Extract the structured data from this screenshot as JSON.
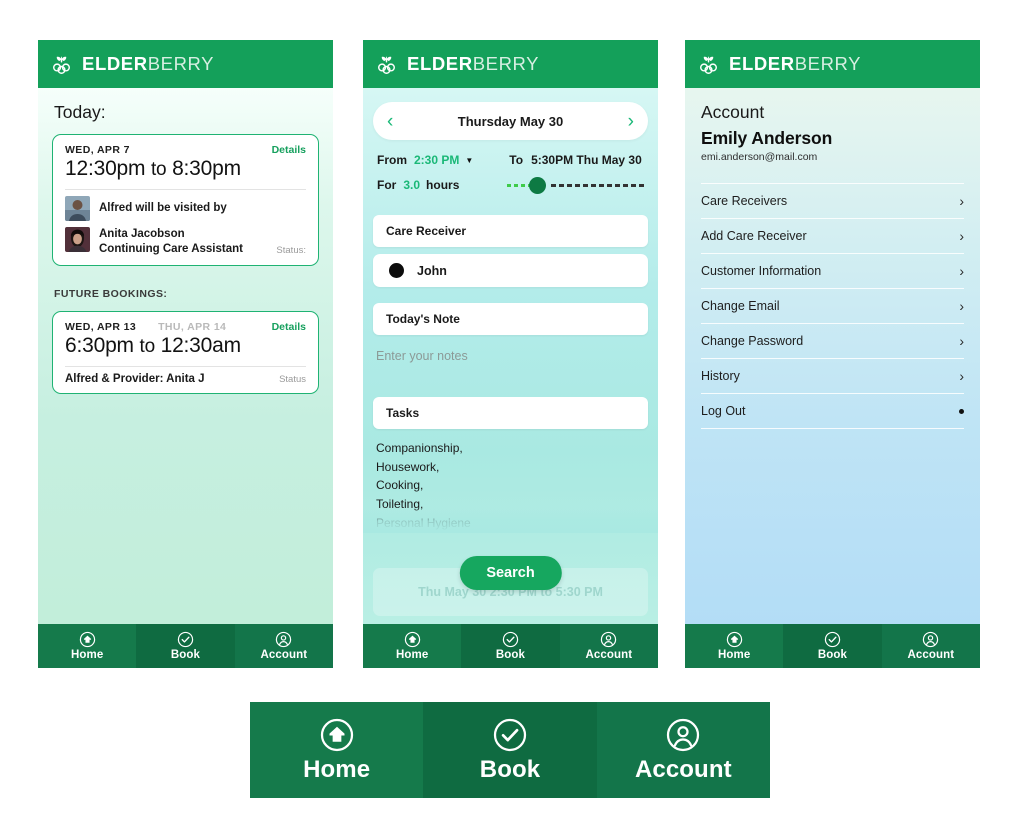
{
  "brand": {
    "strong": "ELDER",
    "light": "BERRY",
    "logo_icon": "elderberry-logo-icon",
    "bar_color": "#14a05a"
  },
  "nav": {
    "items": [
      {
        "label": "Home",
        "icon": "home-circle-icon"
      },
      {
        "label": "Book",
        "icon": "check-circle-icon"
      },
      {
        "label": "Account",
        "icon": "user-circle-icon"
      }
    ]
  },
  "home": {
    "title": "Today:",
    "today_booking": {
      "date": "WED, APR 7",
      "details_label": "Details",
      "time_from": "12:30pm",
      "time_sep": "to",
      "time_to": "8:30pm",
      "receiver_line": "Alfred will be visited by",
      "provider_name": "Anita Jacobson",
      "provider_role": "Continuing Care Assistant",
      "status_label": "Status:"
    },
    "future_label": "FUTURE BOOKINGS:",
    "future_booking": {
      "date_start": "WED, APR 13",
      "date_end": "THU, APR 14",
      "details_label": "Details",
      "time_from": "6:30pm",
      "time_sep": "to",
      "time_to": "12:30am",
      "summary": "Alfred & Provider: Anita J",
      "status_label": "Status"
    }
  },
  "book": {
    "date_nav": {
      "prev_icon": "chevron-left-icon",
      "next_icon": "chevron-right-icon",
      "date": "Thursday May 30"
    },
    "time": {
      "from_label": "From",
      "from_value": "2:30 PM",
      "dropdown_icon": "caret-down-icon",
      "to_label": "To",
      "to_value": "5:30PM Thu May 30",
      "for_label": "For",
      "duration_value": "3.0",
      "hours_label": "hours",
      "slider_icon": "duration-slider"
    },
    "care_receiver": {
      "heading": "Care Receiver",
      "selected": "John"
    },
    "note": {
      "heading": "Today's Note",
      "placeholder": "Enter your notes"
    },
    "tasks": {
      "heading": "Tasks",
      "items": [
        "Companionship,",
        "Housework,",
        "Cooking,",
        "Toileting,",
        "Personal Hygiene"
      ]
    },
    "search_button": "Search",
    "summary_ghost": "Thu May 30 2:30 PM to 5:30 PM"
  },
  "account": {
    "title": "Account",
    "name": "Emily Anderson",
    "email": "emi.anderson@mail.com",
    "items": [
      {
        "label": "Care Receivers",
        "accessory": "chevron"
      },
      {
        "label": "Add Care Receiver",
        "accessory": "chevron"
      },
      {
        "label": "Customer Information",
        "accessory": "chevron"
      },
      {
        "label": "Change Email",
        "accessory": "chevron"
      },
      {
        "label": "Change Password",
        "accessory": "chevron"
      },
      {
        "label": "History",
        "accessory": "chevron"
      },
      {
        "label": "Log Out",
        "accessory": "dot"
      }
    ],
    "chevron_glyph": "›"
  },
  "colors": {
    "brand_green": "#14a05a",
    "accent_green": "#1ab877",
    "nav_green": "#157a4b",
    "search_green": "#16a75f"
  }
}
